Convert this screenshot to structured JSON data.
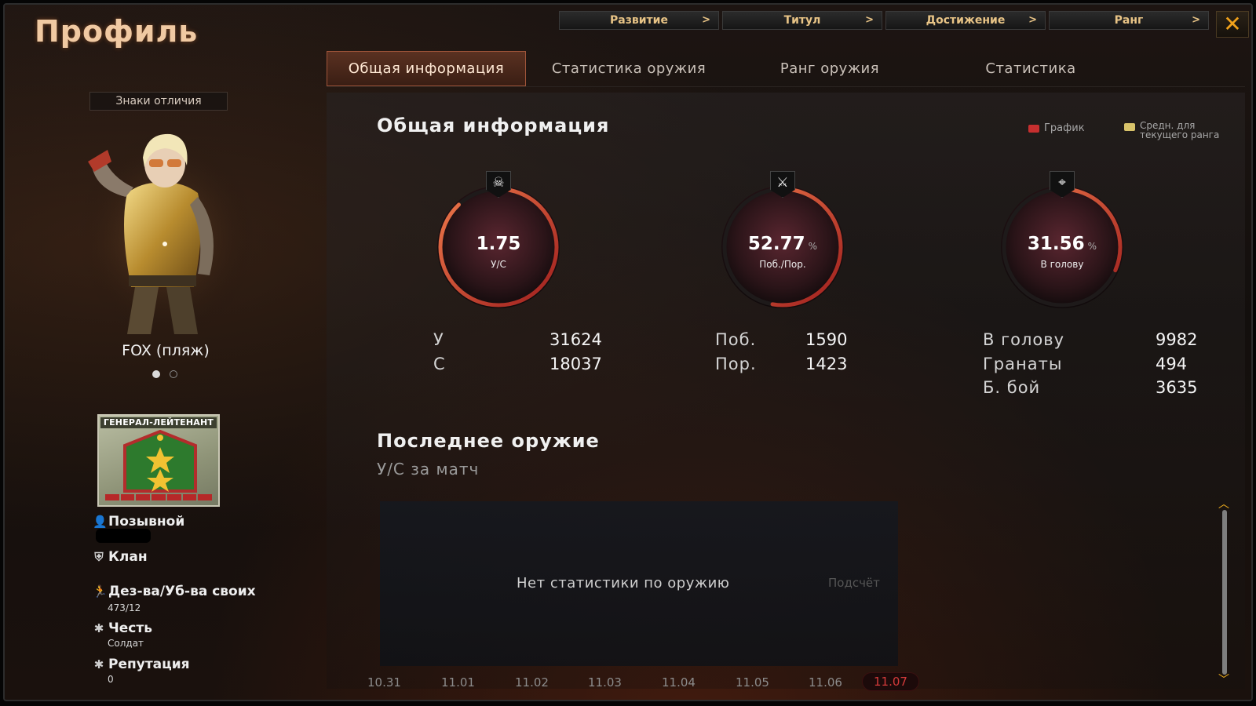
{
  "window": {
    "title": "Профиль"
  },
  "topnav": [
    {
      "label": "Развитие"
    },
    {
      "label": "Титул"
    },
    {
      "label": "Достижение"
    },
    {
      "label": "Ранг"
    }
  ],
  "close_label": "✕",
  "tabs": [
    {
      "label": "Общая информация",
      "active": true
    },
    {
      "label": "Статистика оружия",
      "active": false
    },
    {
      "label": "Ранг оружия",
      "active": false
    },
    {
      "label": "Статистика",
      "active": false
    }
  ],
  "sidebar": {
    "insignia_button": "Знаки отличия",
    "character_name": "FOX (пляж)",
    "rank_name": "ГЕНЕРАЛ-ЛЕЙТЕНАНТ",
    "rank_progress_segments_filled": 7,
    "rank_progress_segments_total": 7,
    "callsign_label": "Позывной",
    "clan_label": "Клан",
    "desertions_label": "Дез-ва/Уб-ва своих",
    "desertions_value": "473/12",
    "honor_label": "Честь",
    "honor_value": "Солдат",
    "reputation_label": "Репутация",
    "reputation_value": "0"
  },
  "main": {
    "title": "Общая информация",
    "legend": [
      {
        "label": "График",
        "color": "#c62f2f"
      },
      {
        "label": "Средн. для текущего ранга",
        "color": "#d8c36a"
      }
    ],
    "gauges": [
      {
        "value": "1.75",
        "unit": "",
        "label": "У/С",
        "icon": "skull-icon",
        "fill": 0.88
      },
      {
        "value": "52.77",
        "unit": "%",
        "label": "Поб./Пор.",
        "icon": "crossed-rifles-icon",
        "fill": 0.5277
      },
      {
        "value": "31.56",
        "unit": "%",
        "label": "В голову",
        "icon": "headshot-icon",
        "fill": 0.3156
      }
    ],
    "stats_kills": [
      {
        "label": "У",
        "value": "31624"
      },
      {
        "label": "С",
        "value": "18037"
      }
    ],
    "stats_wins": [
      {
        "label": "Поб.",
        "value": "1590"
      },
      {
        "label": "Пор.",
        "value": "1423"
      }
    ],
    "stats_other": [
      {
        "label": "В голову",
        "value": "9982"
      },
      {
        "label": "Гранаты",
        "value": "494"
      },
      {
        "label": "Б. бой",
        "value": "3635"
      }
    ],
    "recent_weapon": {
      "title": "Последнее оружие",
      "subtitle": "У/С за матч",
      "empty_text": "Нет статистики по оружию",
      "count_label": "Подсчёт",
      "dates": [
        "10.31",
        "11.01",
        "11.02",
        "11.03",
        "11.04",
        "11.05",
        "11.06",
        "11.07"
      ],
      "current_date": "11.07"
    }
  },
  "colors": {
    "accent": "#f2a21b",
    "gauge_arc_start": "#b3211f",
    "gauge_arc_end": "#ef7a4b",
    "active_tab": "#5a3121"
  }
}
